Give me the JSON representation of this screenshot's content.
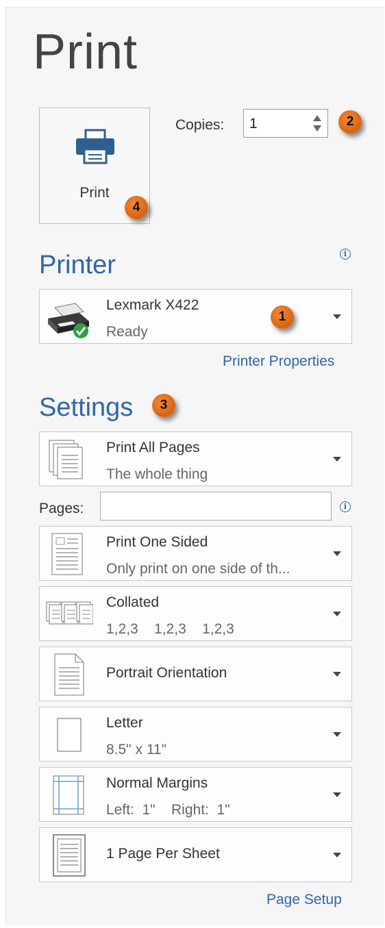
{
  "title": "Print",
  "print_button": {
    "label": "Print",
    "icon": "printer-icon",
    "badge": "4"
  },
  "copies": {
    "label": "Copies:",
    "value": "1",
    "badge": "2"
  },
  "printer": {
    "heading": "Printer",
    "name": "Lexmark X422",
    "status": "Ready",
    "badge": "1",
    "properties_link": "Printer Properties"
  },
  "settings": {
    "heading": "Settings",
    "badge": "3",
    "pages_label": "Pages:",
    "pages_value": "",
    "options": [
      {
        "title": "Print All Pages",
        "subtitle": "The whole thing",
        "icon": "pages-stack-icon"
      },
      {
        "title": "Print One Sided",
        "subtitle": "Only print on one side of th...",
        "icon": "one-sided-icon"
      },
      {
        "title": "Collated",
        "subtitle": "1,2,3    1,2,3    1,2,3",
        "icon": "collated-icon"
      },
      {
        "title": "Portrait Orientation",
        "subtitle": "",
        "icon": "portrait-icon"
      },
      {
        "title": "Letter",
        "subtitle": "8.5\" x 11\"",
        "icon": "paper-size-icon"
      },
      {
        "title": "Normal Margins",
        "subtitle": "Left:  1\"    Right:  1\"",
        "icon": "margins-icon"
      },
      {
        "title": "1 Page Per Sheet",
        "subtitle": "",
        "icon": "page-per-sheet-icon"
      }
    ],
    "page_setup_link": "Page Setup"
  },
  "colors": {
    "accent": "#2e65ad",
    "badge": "#e0701c",
    "text": "#333333"
  }
}
